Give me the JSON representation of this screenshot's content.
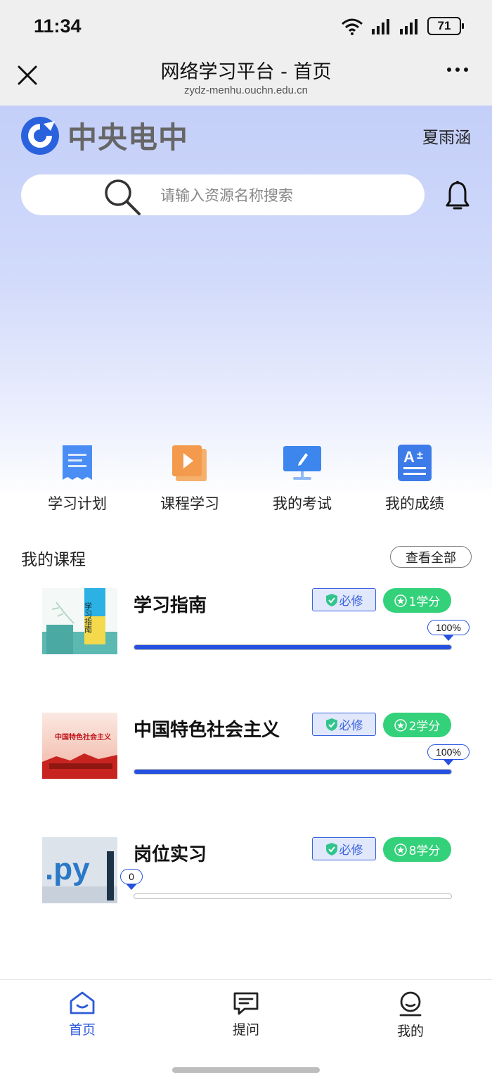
{
  "status": {
    "time": "11:34",
    "battery": "71"
  },
  "titlebar": {
    "title": "网络学习平台 - 首页",
    "url": "zydz-menhu.ouchn.edu.cn"
  },
  "header": {
    "logo_text": "中央电中",
    "user_name": "夏雨涵"
  },
  "search": {
    "placeholder": "请输入资源名称搜索"
  },
  "quick_entries": [
    {
      "label": "学习计划",
      "icon": "plan-icon"
    },
    {
      "label": "课程学习",
      "icon": "course-icon"
    },
    {
      "label": "我的考试",
      "icon": "exam-icon"
    },
    {
      "label": "我的成绩",
      "icon": "grade-icon"
    }
  ],
  "courses_section": {
    "title": "我的课程",
    "view_all": "查看全部"
  },
  "courses": [
    {
      "title": "学习指南",
      "required_tag": "必修",
      "credit": "1学分",
      "progress": 100,
      "progress_label": "100%",
      "thumb_text": "学习指南"
    },
    {
      "title": "中国特色社会主义",
      "required_tag": "必修",
      "credit": "2学分",
      "progress": 100,
      "progress_label": "100%",
      "thumb_text": "中国特色社会主义"
    },
    {
      "title": "岗位实习",
      "required_tag": "必修",
      "credit": "8学分",
      "progress": 0,
      "progress_label": "0",
      "thumb_text": ".py"
    }
  ],
  "bottom_nav": [
    {
      "label": "首页",
      "icon": "home-icon",
      "active": true
    },
    {
      "label": "提问",
      "icon": "question-icon",
      "active": false
    },
    {
      "label": "我的",
      "icon": "profile-icon",
      "active": false
    }
  ],
  "colors": {
    "accent": "#2651e0",
    "credit_green": "#33d17a",
    "hero_top": "#c4cff9"
  }
}
